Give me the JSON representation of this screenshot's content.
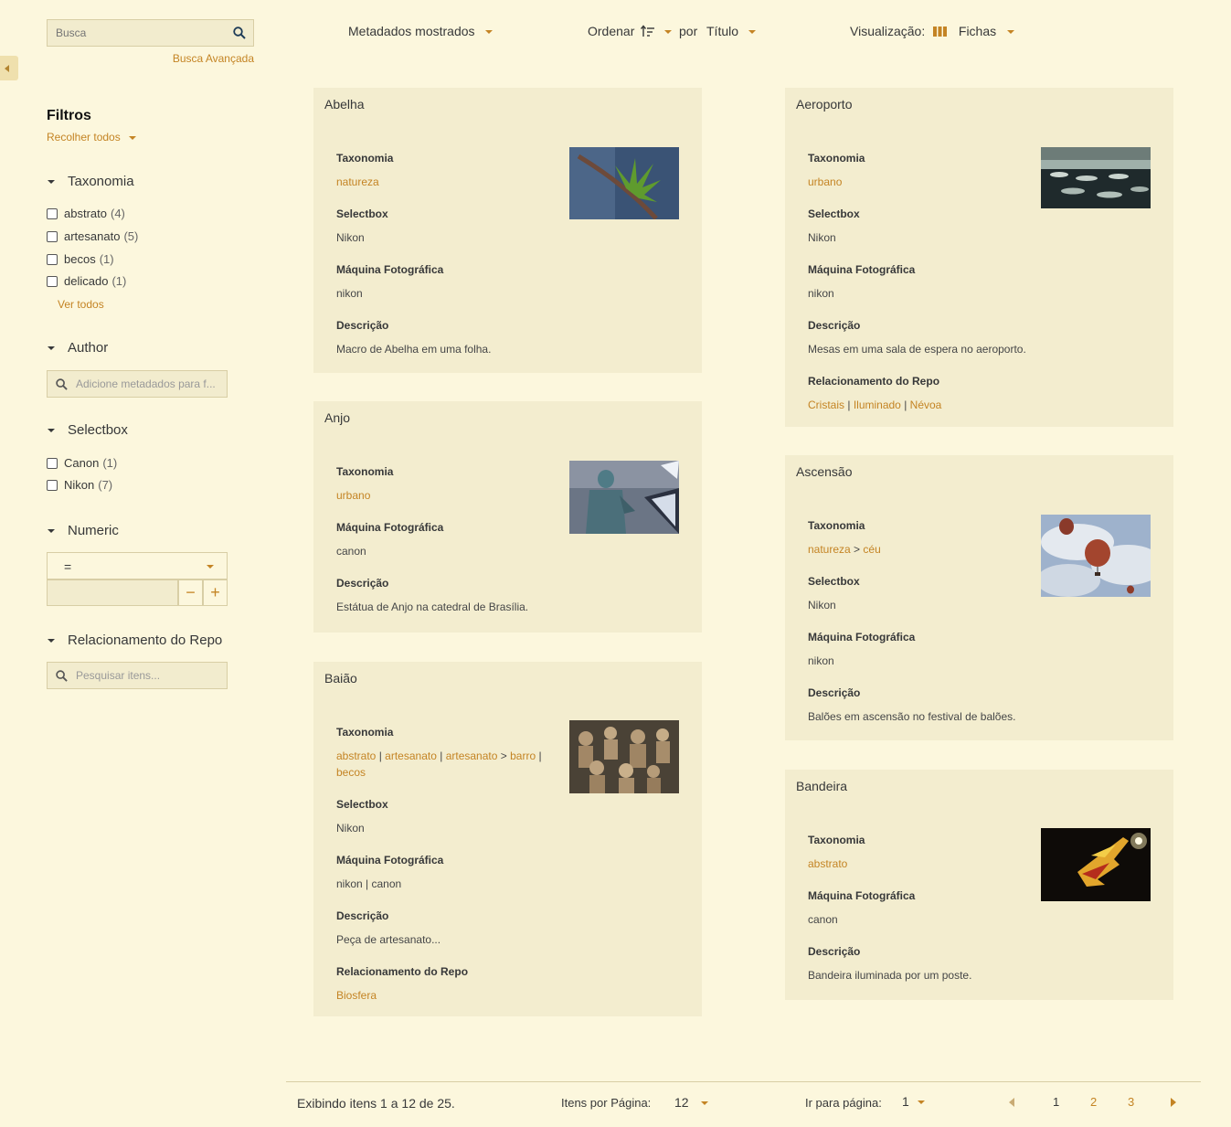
{
  "search": {
    "placeholder": "Busca",
    "advanced_label": "Busca Avançada"
  },
  "filters": {
    "title": "Filtros",
    "collapse_all": "Recolher todos",
    "taxonomia": {
      "label": "Taxonomia",
      "options": [
        {
          "label": "abstrato",
          "count": "(4)"
        },
        {
          "label": "artesanato",
          "count": "(5)"
        },
        {
          "label": "becos",
          "count": "(1)"
        },
        {
          "label": "delicado",
          "count": "(1)"
        }
      ],
      "see_all": "Ver todos"
    },
    "author": {
      "label": "Author",
      "placeholder": "Adicione metadados para f..."
    },
    "selectbox": {
      "label": "Selectbox",
      "options": [
        {
          "label": "Canon",
          "count": "(1)"
        },
        {
          "label": "Nikon",
          "count": "(7)"
        }
      ]
    },
    "numeric": {
      "label": "Numeric",
      "operator": "=",
      "minus": "−",
      "plus": "+"
    },
    "repo": {
      "label": "Relacionamento do Repo",
      "placeholder": "Pesquisar itens..."
    }
  },
  "toolbar": {
    "metadata_shown": "Metadados mostrados",
    "order": "Ordenar",
    "by": "por",
    "order_field": "Título",
    "view_label": "Visualização:",
    "view_mode": "Fichas"
  },
  "cards": {
    "abelha": {
      "title": "Abelha",
      "taxonomia_label": "Taxonomia",
      "taxonomia": "natureza",
      "selectbox_label": "Selectbox",
      "selectbox": "Nikon",
      "maquina_label": "Máquina Fotográfica",
      "maquina": "nikon",
      "descricao_label": "Descrição",
      "descricao": "Macro de Abelha em uma folha."
    },
    "anjo": {
      "title": "Anjo",
      "taxonomia_label": "Taxonomia",
      "taxonomia": "urbano",
      "maquina_label": "Máquina Fotográfica",
      "maquina": "canon",
      "descricao_label": "Descrição",
      "descricao": "Estátua de Anjo na catedral de Brasília."
    },
    "baiao": {
      "title": "Baião",
      "taxonomia_label": "Taxonomia",
      "taxonomia_links": [
        "abstrato",
        "artesanato",
        "artesanato",
        "barro",
        "becos"
      ],
      "selectbox_label": "Selectbox",
      "selectbox": "Nikon",
      "maquina_label": "Máquina Fotográfica",
      "maquina": "nikon | canon",
      "descricao_label": "Descrição",
      "descricao": "Peça de artesanato...",
      "repo_label": "Relacionamento do Repo",
      "repo": "Biosfera"
    },
    "aeroporto": {
      "title": "Aeroporto",
      "taxonomia_label": "Taxonomia",
      "taxonomia": "urbano",
      "selectbox_label": "Selectbox",
      "selectbox": "Nikon",
      "maquina_label": "Máquina Fotográfica",
      "maquina": "nikon",
      "descricao_label": "Descrição",
      "descricao": "Mesas em uma sala de espera no aeroporto.",
      "repo_label": "Relacionamento do Repo",
      "repo_links": [
        "Cristais",
        "Iluminado",
        "Névoa"
      ]
    },
    "ascensao": {
      "title": "Ascensão",
      "taxonomia_label": "Taxonomia",
      "taxonomia_links": [
        "natureza",
        "céu"
      ],
      "selectbox_label": "Selectbox",
      "selectbox": "Nikon",
      "maquina_label": "Máquina Fotográfica",
      "maquina": "nikon",
      "descricao_label": "Descrição",
      "descricao": "Balões em ascensão no festival de balões."
    },
    "bandeira": {
      "title": "Bandeira",
      "taxonomia_label": "Taxonomia",
      "taxonomia": "abstrato",
      "maquina_label": "Máquina Fotográfica",
      "maquina": "canon",
      "descricao_label": "Descrição",
      "descricao": "Bandeira iluminada por um poste."
    }
  },
  "pagination": {
    "showing": "Exibindo itens 1 a 12 de 25.",
    "per_page_label": "Itens por Página:",
    "per_page": "12",
    "goto_label": "Ir para página:",
    "goto_value": "1",
    "pages": [
      "1",
      "2",
      "3"
    ]
  },
  "colors": {
    "background": "#fcf7dd",
    "card": "#f3edcf",
    "accent": "#c48424"
  }
}
